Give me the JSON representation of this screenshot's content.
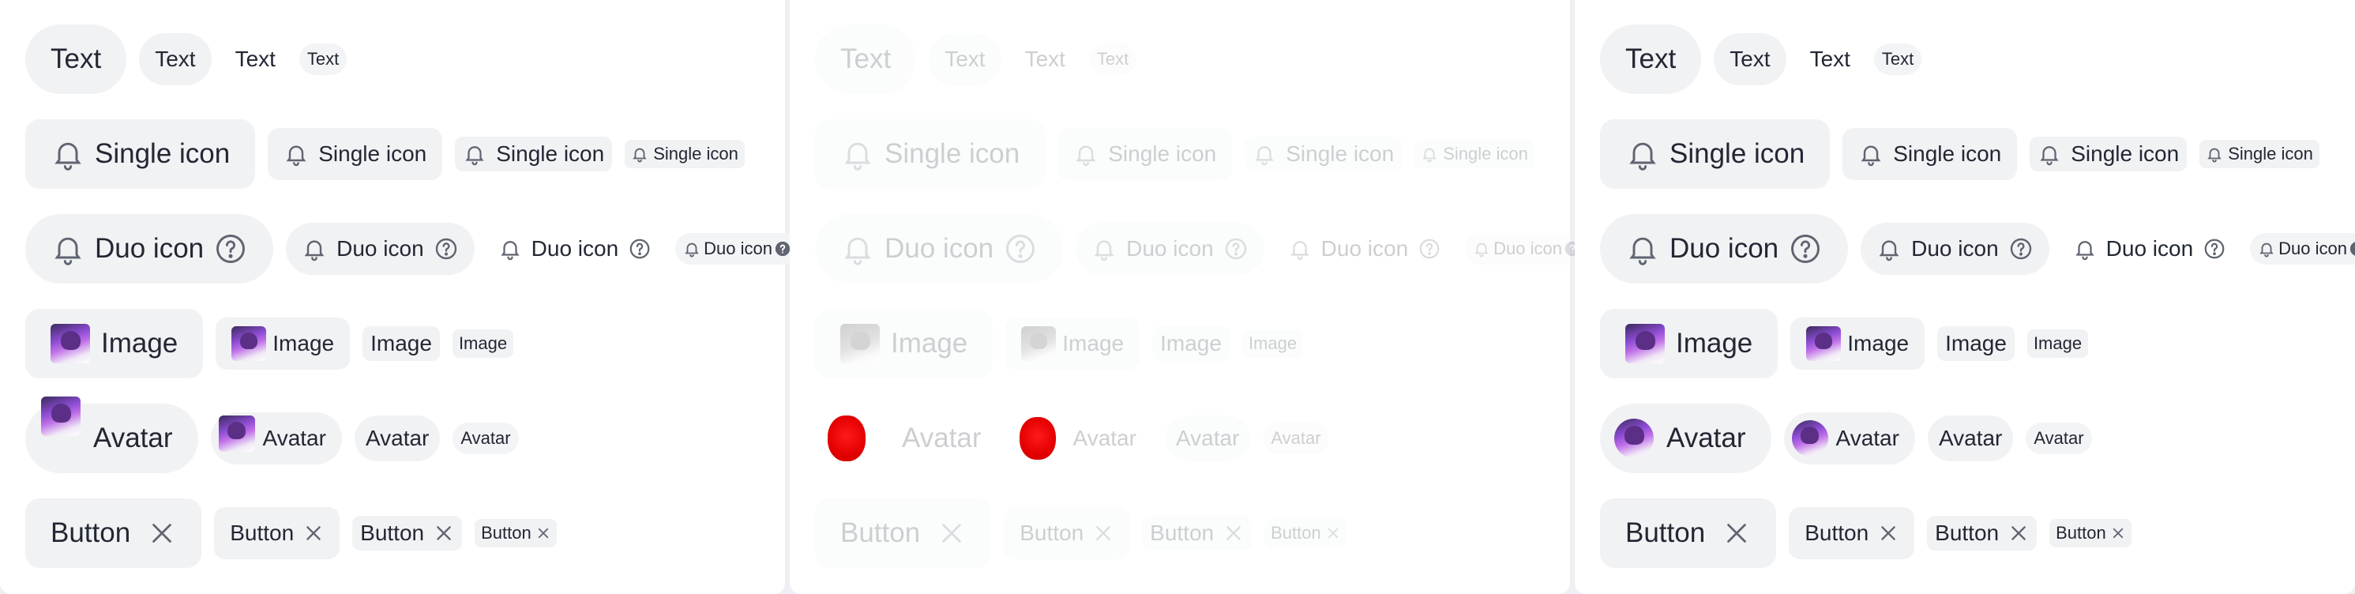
{
  "panels": [
    {
      "state": "default",
      "rows": {
        "text": [
          "Text",
          "Text",
          "Text",
          "Text"
        ],
        "single_icon": [
          "Single icon",
          "Single icon",
          "Single icon",
          "Single icon"
        ],
        "duo_icon": [
          "Duo icon",
          "Duo icon",
          "Duo icon",
          "Duo icon"
        ],
        "image": [
          "Image",
          "Image",
          "Image",
          "Image"
        ],
        "avatar": [
          "Avatar",
          "Avatar",
          "Avatar",
          "Avatar"
        ],
        "button": [
          "Button",
          "Button",
          "Button",
          "Button"
        ]
      }
    },
    {
      "state": "disabled",
      "rows": {
        "text": [
          "Text",
          "Text",
          "Text",
          "Text"
        ],
        "single_icon": [
          "Single icon",
          "Single icon",
          "Single icon",
          "Single icon"
        ],
        "duo_icon": [
          "Duo icon",
          "Duo icon",
          "Duo icon",
          "Duo icon"
        ],
        "image": [
          "Image",
          "Image",
          "Image",
          "Image"
        ],
        "avatar": [
          "Avatar",
          "Avatar",
          "Avatar",
          "Avatar"
        ],
        "button": [
          "Button",
          "Button",
          "Button",
          "Button"
        ]
      }
    },
    {
      "state": "default",
      "rows": {
        "text": [
          "Text",
          "Text",
          "Text",
          "Text"
        ],
        "single_icon": [
          "Single icon",
          "Single icon",
          "Single icon",
          "Single icon"
        ],
        "duo_icon": [
          "Duo icon",
          "Duo icon",
          "Duo icon",
          "Duo icon"
        ],
        "image": [
          "Image",
          "Image",
          "Image",
          "Image"
        ],
        "avatar": [
          "Avatar",
          "Avatar",
          "Avatar",
          "Avatar"
        ],
        "button": [
          "Button",
          "Button",
          "Button",
          "Button"
        ]
      }
    }
  ],
  "icons": {
    "single": "bell-icon",
    "duo_leading": "bell-icon",
    "duo_trailing": "help-circle-icon",
    "button_trailing": "close-icon"
  },
  "colors": {
    "chip_bg": "#f1f2f4",
    "text": "#222733",
    "icon": "#5f6470",
    "avatar_placeholder": "#e30000"
  }
}
